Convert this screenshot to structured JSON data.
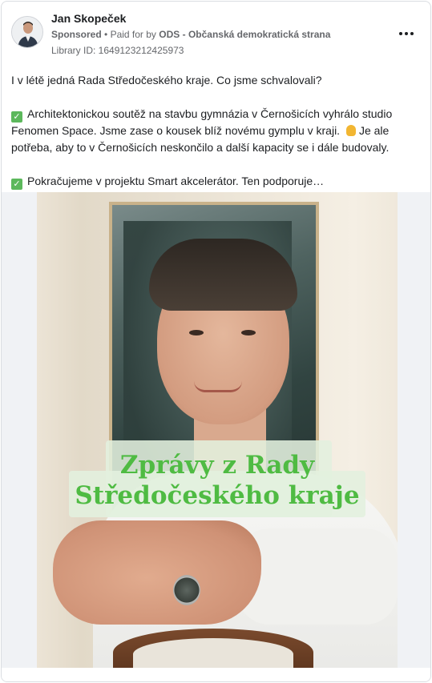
{
  "post": {
    "author": "Jan Skopeček",
    "sponsored_label": "Sponsored",
    "paid_for_prefix": "Paid for by",
    "paid_for_by": "ODS - Občanská demokratická strana",
    "library_id": "Library ID: 1649123212425973",
    "body": {
      "line1": "I v létě jedná Rada Středočeského kraje. Co jsme schvalovali?",
      "para2": "Architektonickou soutěž na stavbu gymnázia v Černošicích vyhrálo studio Fenomen Space. Jsme zase o kousek blíž novému gymplu v kraji.",
      "para2_tail": "Je ale potřeba, aby to v Černošicích neskončilo a další kapacity se i dále budovaly.",
      "para3": "Pokračujeme v projektu Smart akcelerátor. Ten podporuje…"
    },
    "image": {
      "overlay_line1": "Zprávy z Rady",
      "overlay_line2": "Středočeského kraje"
    }
  },
  "colors": {
    "overlay_text": "#4fbb43",
    "check_emoji": "#5cb85c",
    "meta_text": "#65676b"
  },
  "icons": [
    "more-options-icon",
    "check-mark-emoji-icon",
    "pinched-fingers-emoji-icon"
  ]
}
